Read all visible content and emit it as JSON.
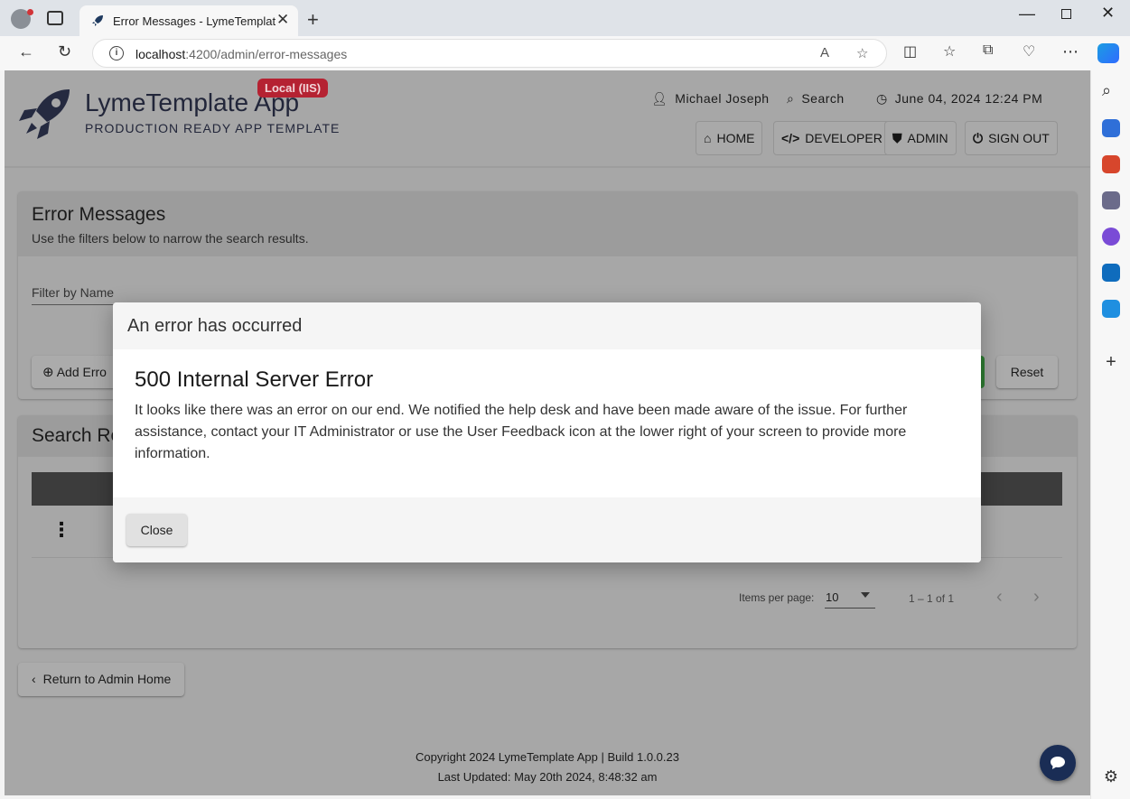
{
  "browser": {
    "tab_title": "Error Messages - LymeTemplate A",
    "url_host": "localhost",
    "url_path": ":4200/admin/error-messages"
  },
  "app": {
    "title": "LymeTemplate App",
    "env_badge": "Local (IIS)",
    "subtitle": "PRODUCTION READY APP TEMPLATE",
    "user_name": "Michael Joseph",
    "search_label": "Search",
    "datetime": "June 04, 2024 12:24 PM",
    "nav": [
      {
        "label": "HOME",
        "icon": "home-icon"
      },
      {
        "label": "DEVELOPER",
        "icon": "code-icon"
      },
      {
        "label": "ADMIN",
        "icon": "shield-icon"
      },
      {
        "label": "SIGN OUT",
        "icon": "power-icon"
      }
    ]
  },
  "filters_card": {
    "title": "Error Messages",
    "subtitle": "Use the filters below to narrow the search results.",
    "filter_placeholder": "Filter by Name",
    "add_button": "Add Erro",
    "reset_button": "Reset"
  },
  "results_card": {
    "title": "Search Re",
    "items_per_page_label": "Items per page:",
    "items_per_page": "10",
    "range": "1 – 1 of 1"
  },
  "return_button": "Return to Admin Home",
  "footer": {
    "copyright": "Copyright 2024 LymeTemplate App | Build 1.0.0.23",
    "last_updated": "Last Updated: May 20th 2024, 8:48:32 am"
  },
  "modal": {
    "header": "An error has occurred",
    "title": "500 Internal Server Error",
    "message": "It looks like there was an error on our end. We notified the help desk and have been made aware of the issue. For further assistance, contact your IT Administrator or use the User Feedback icon at the lower right of your screen to provide more information.",
    "close_button": "Close"
  },
  "colors": {
    "env_badge": "#b52232",
    "brand_navy": "#22263a",
    "feedback_button": "#1a2d55",
    "overlay_gray": "#a7a7a7"
  }
}
